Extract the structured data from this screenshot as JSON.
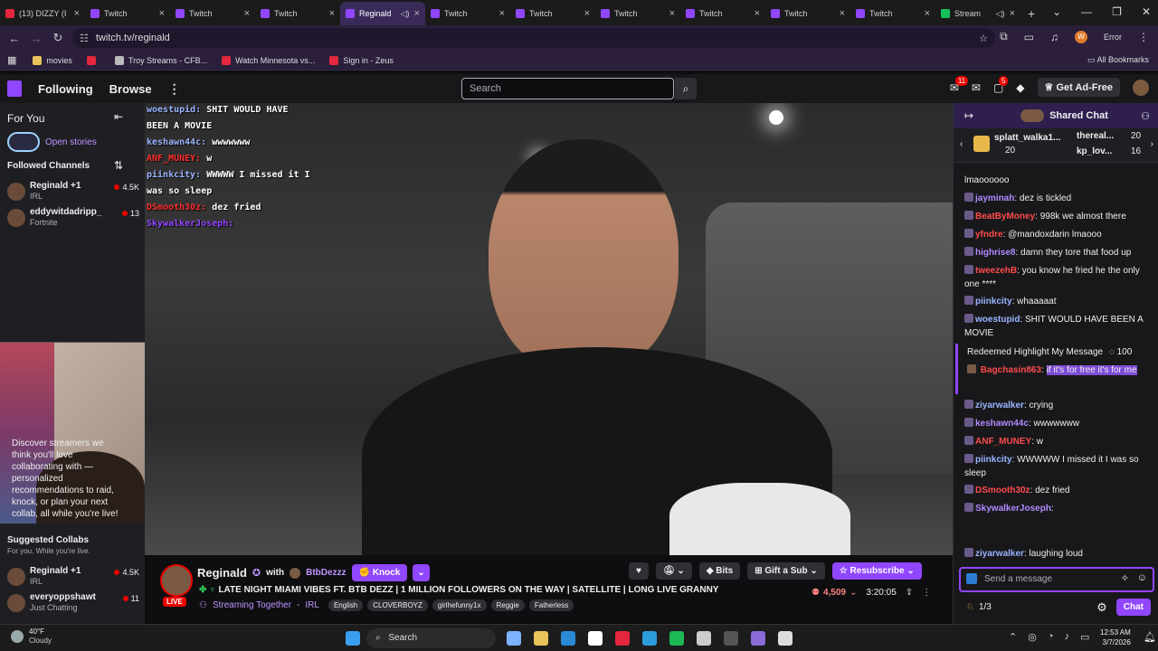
{
  "browser": {
    "tabs": [
      {
        "title": "(13) DIZZY (I",
        "icon": "youtube",
        "active": false
      },
      {
        "title": "Twitch",
        "icon": "twitch",
        "active": false
      },
      {
        "title": "Twitch",
        "icon": "twitch",
        "active": false
      },
      {
        "title": "Twitch",
        "icon": "twitch",
        "active": false
      },
      {
        "title": "Reginald",
        "icon": "twitch",
        "active": true
      },
      {
        "title": "Twitch",
        "icon": "twitch",
        "active": false
      },
      {
        "title": "Twitch",
        "icon": "twitch",
        "active": false
      },
      {
        "title": "Twitch",
        "icon": "twitch",
        "active": false
      },
      {
        "title": "Twitch",
        "icon": "twitch",
        "active": false
      },
      {
        "title": "Twitch",
        "icon": "twitch",
        "active": false
      },
      {
        "title": "Twitch",
        "icon": "twitch",
        "active": false
      },
      {
        "title": "Stream",
        "icon": "green",
        "active": false
      }
    ],
    "url": "twitch.tv/reginald",
    "profile_initial": "W",
    "error_label": "Error",
    "bookmarks": [
      {
        "label": "movies",
        "color": "#e8c35a"
      },
      {
        "label": "",
        "color": "#e4273c"
      },
      {
        "label": "Troy Streams - CFB...",
        "color": "#bbbbbb"
      },
      {
        "label": "Watch Minnesota vs...",
        "color": "#e4273c"
      },
      {
        "label": "Sign in - Zeus",
        "color": "#e4273c"
      }
    ],
    "all_bookmarks": "All Bookmarks"
  },
  "twitch_nav": {
    "following": "Following",
    "browse": "Browse",
    "search_placeholder": "Search",
    "notif_count": "11",
    "whisper_count": "5",
    "get_ad_free": "Get Ad-Free"
  },
  "sidebar": {
    "for_you": "For You",
    "open_stories": "Open stories",
    "followed_channels": "Followed Channels",
    "channels": [
      {
        "name": "Reginald +1",
        "category": "IRL",
        "viewers": "4.5K"
      },
      {
        "name": "eddywitdadripp_",
        "category": "Fortnite",
        "viewers": "13"
      }
    ],
    "collab_text": "Discover streamers we think you'll love collaborating with — personalized recommendations to raid, knock, or plan your next collab, all while you're live!",
    "suggested_title": "Suggested Collabs",
    "suggested_sub": "For you. While you're live.",
    "suggested": [
      {
        "name": "Reginald +1",
        "category": "IRL",
        "viewers": "4.5K"
      },
      {
        "name": "everyoppshawt",
        "category": "Just Chatting",
        "viewers": "11"
      }
    ]
  },
  "video_overlay": {
    "lines": [
      {
        "user": "woestupid:",
        "text": "SHIT WOULD HAVE",
        "color": "#9ab4ff"
      },
      {
        "user": "",
        "text": "BEEN A MOVIE",
        "color": "#ffffff"
      },
      {
        "user": "keshawn44c:",
        "text": "wwwwwww",
        "color": "#9ab4ff"
      },
      {
        "user": "ANF_MUNEY:",
        "text": "w",
        "color": "#ff3030"
      },
      {
        "user": "piinkcity:",
        "text": "WWWWW I missed it I",
        "color": "#9ab4ff"
      },
      {
        "user": "",
        "text": "was so sleep",
        "color": "#ffffff"
      },
      {
        "user": "DSmooth30z:",
        "text": "dez fried",
        "color": "#ff3030"
      },
      {
        "user": "SkywalkerJoseph:",
        "text": "",
        "color": "#9146ff"
      }
    ]
  },
  "stream": {
    "streamer": "Reginald",
    "with_label": "with",
    "collab": "BtbDezzz",
    "knock": "Knock",
    "title": "LATE NIGHT MIAMI VIBES FT. BTB DEZZ | 1 MILLION FOLLOWERS ON THE WAY | SATELLITE | LONG LIVE GRANNY",
    "live": "LIVE",
    "streaming_together": "Streaming Together",
    "category": "IRL",
    "tags": [
      "English",
      "CLOVERBOYZ",
      "girlhefunny1x",
      "Reggie",
      "Fatherless"
    ],
    "bits": "Bits",
    "gift_a_sub": "Gift a Sub",
    "resubscribe": "Resubscribe",
    "viewers": "4,509",
    "uptime": "3:20:05"
  },
  "chat": {
    "header": "Shared Chat",
    "gifters": [
      {
        "name": "splatt_walka1...",
        "count": "20"
      },
      {
        "name": "thereal...",
        "count": "20"
      },
      {
        "name": "kp_lov...",
        "count": "16"
      }
    ],
    "messages": [
      {
        "user": "",
        "text": "lmaoooooo",
        "color": "#efeff1"
      },
      {
        "user": "jayminah",
        "text": "dez is tickled",
        "color": "#b28bff"
      },
      {
        "user": "BeatByMoney",
        "text": "998k we almost there",
        "color": "#ff4b4b"
      },
      {
        "user": "yfndre",
        "text": "@mandoxdarin lmaooo",
        "color": "#ff4b4b"
      },
      {
        "user": "highrise8",
        "text": "damn they tore that food up",
        "color": "#b28bff"
      },
      {
        "user": "tweezehB",
        "text": "you know he fried he the only one ****",
        "color": "#ff4b4b"
      },
      {
        "user": "piinkcity",
        "text": "whaaaaat",
        "color": "#9ab4ff"
      },
      {
        "user": "woestupid",
        "text": "SHIT WOULD HAVE BEEN A MOVIE",
        "color": "#9ab4ff"
      },
      {
        "user": "ziyarwalker",
        "text": "crying",
        "color": "#9ab4ff"
      },
      {
        "user": "keshawn44c",
        "text": "wwwwwww",
        "color": "#b28bff"
      },
      {
        "user": "ANF_MUNEY",
        "text": "w",
        "color": "#ff4b4b"
      },
      {
        "user": "piinkcity",
        "text": "WWWWW I missed it I was so sleep",
        "color": "#9ab4ff"
      },
      {
        "user": "DSmooth30z",
        "text": "dez fried",
        "color": "#ff4b4b"
      },
      {
        "user": "SkywalkerJoseph",
        "text": "",
        "color": "#b28bff"
      },
      {
        "user": "ziyarwalker",
        "text": "laughing loud",
        "color": "#9ab4ff"
      }
    ],
    "redeem_label": "Redeemed Highlight My Message",
    "redeem_cost": "100",
    "redeem_user": "Bagchasin863",
    "redeem_text": "if it's for free it's for me",
    "input_placeholder": "Send a message",
    "points": "1/3",
    "chat_button": "Chat"
  },
  "taskbar": {
    "temp": "40°F",
    "weather": "Cloudy",
    "search": "Search",
    "time": "12:53 AM",
    "date": "3/7/2026"
  }
}
